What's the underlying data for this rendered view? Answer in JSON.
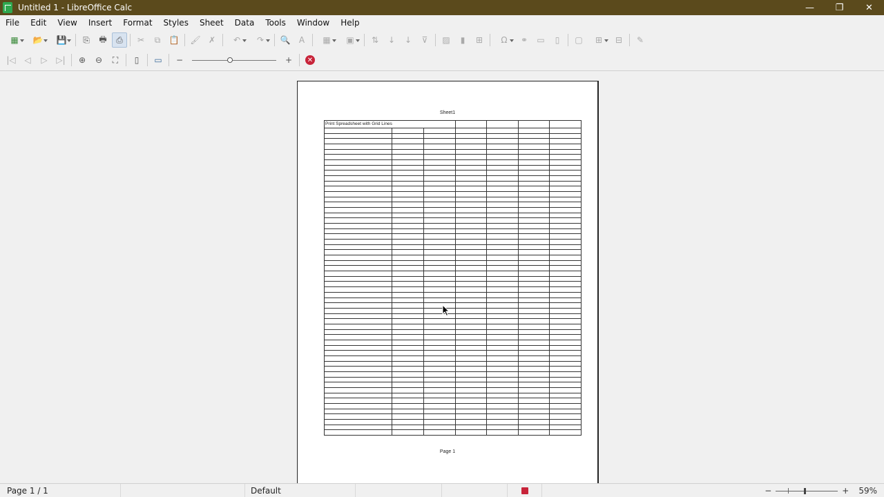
{
  "window": {
    "title": "Untitled 1 - LibreOffice Calc",
    "minimize": "—",
    "restore": "❐",
    "close": "✕"
  },
  "menu": [
    "File",
    "Edit",
    "View",
    "Insert",
    "Format",
    "Styles",
    "Sheet",
    "Data",
    "Tools",
    "Window",
    "Help"
  ],
  "toolbar1": {
    "new": "▦",
    "open": "📂",
    "save": "💾",
    "export_pdf": "⎘",
    "print": "🖶",
    "print_preview": "⎙",
    "cut": "✂",
    "copy": "⧉",
    "paste": "📋",
    "clone": "🖌",
    "clear": "✗",
    "undo": "↶",
    "redo": "↷",
    "find": "🔍",
    "spelling": "A",
    "borders": "▦",
    "merge": "▣",
    "sort": "⇅",
    "sort_asc": "↓",
    "sort_desc": "↓",
    "autofilter": "⊽",
    "image": "▨",
    "chart": "▮",
    "pivot": "⊞",
    "special_char": "Ω",
    "hyperlink": "⚭",
    "comment": "▭",
    "headers": "▯",
    "define_print": "▢",
    "freeze": "⊞",
    "split": "⊟",
    "draw": "✎"
  },
  "toolbar2": {
    "first_page": "|◁",
    "prev_page": "◁",
    "next_page": "▷",
    "last_page": "▷|",
    "zoom_in_tool": "⊕",
    "zoom_out_tool": "⊖",
    "full_screen": "⛶",
    "page_format": "▯",
    "margins": "▭",
    "zoom_minus": "−",
    "zoom_plus": "+",
    "zoom_level": 0.45,
    "close_preview": "✕"
  },
  "preview": {
    "header": "Sheet1",
    "cell_a1": "Print Spreadsheet with Grid Lines",
    "columns": 7,
    "rows": 59,
    "footer": "Page 1"
  },
  "status": {
    "page": "Page 1 / 1",
    "style": "Default",
    "zoom_minus": "−",
    "zoom_plus": "+",
    "zoom": "59%",
    "zoom_level": 0.45
  }
}
